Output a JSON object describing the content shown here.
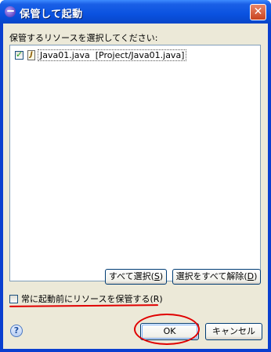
{
  "window": {
    "title": "保管して起動",
    "close_glyph": "✕"
  },
  "dialog": {
    "instruction": "保管するリソースを選択してください:",
    "resources": [
      {
        "checked": true,
        "icon": "java-file-icon",
        "label": "Java01.java  [Project/Java01.java]"
      }
    ],
    "select_all_prefix": "すべて選択(",
    "select_all_mnemonic": "S",
    "select_all_suffix": ")",
    "deselect_all_prefix": "選択をすべて解除(",
    "deselect_all_mnemonic": "D",
    "deselect_all_suffix": ")",
    "always_save": {
      "checked": false,
      "label": "常に起動前にリソースを保管する(R)"
    },
    "help_glyph": "?",
    "ok_label": "OK",
    "cancel_label": "キャンセル"
  },
  "colors": {
    "titlebar": "#0a52e0",
    "dialog_bg": "#ece9d8",
    "annotation_red": "#e00000"
  }
}
